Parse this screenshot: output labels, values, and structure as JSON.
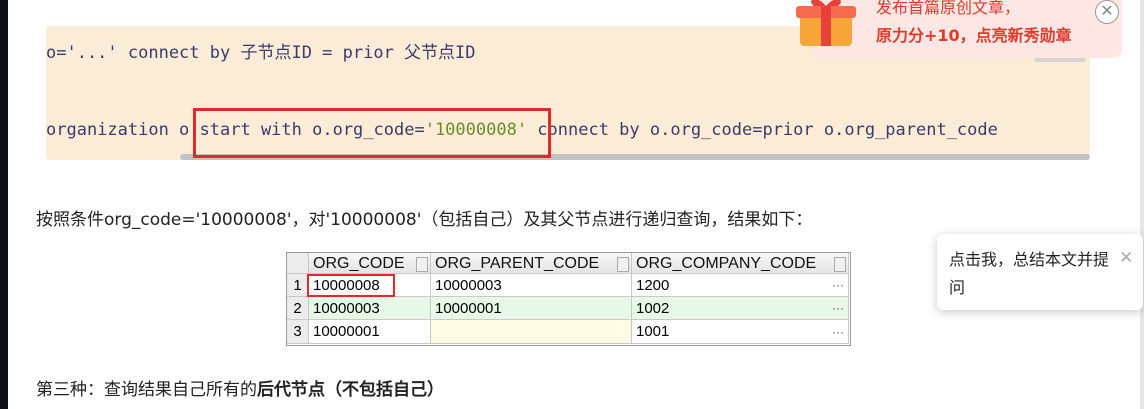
{
  "code": {
    "line1_prefix": "o='...' connect by 子节点ID = prior 父节点ID",
    "line2_a": "organization o ",
    "line2_b": "start with o.org_code=",
    "line2_str": "'10000008'",
    "line2_c": " connect by o.org_code=prior o.org_parent_code"
  },
  "paragraph1": "按照条件org_code='10000008'，对'10000008'（包括自己）及其父节点进行递归查询，结果如下：",
  "paragraph2_plain": "第三种：查询结果自己所有的",
  "paragraph2_bold": "后代节点（不包括自己）",
  "grid": {
    "headers": [
      "ORG_CODE",
      "ORG_PARENT_CODE",
      "ORG_COMPANY_CODE"
    ],
    "rows": [
      {
        "num": "1",
        "org_code": "10000008",
        "parent": "10000003",
        "company": "1200"
      },
      {
        "num": "2",
        "org_code": "10000003",
        "parent": "10000001",
        "company": "1002"
      },
      {
        "num": "3",
        "org_code": "10000001",
        "parent": "",
        "company": "1001"
      }
    ],
    "ellipsis": "···"
  },
  "promo": {
    "top_text": "发布首篇原创文章，",
    "main_text": "原力分+10，点亮新秀勋章",
    "close": "✕"
  },
  "tooltip": {
    "text": "点击我，总结本文并提问",
    "close": "✕"
  },
  "colors": {
    "code_bg": "#fbecd7",
    "highlight_red": "#e0292b",
    "row2_green": "#e6f9e6",
    "promo_red": "#e0392b"
  }
}
